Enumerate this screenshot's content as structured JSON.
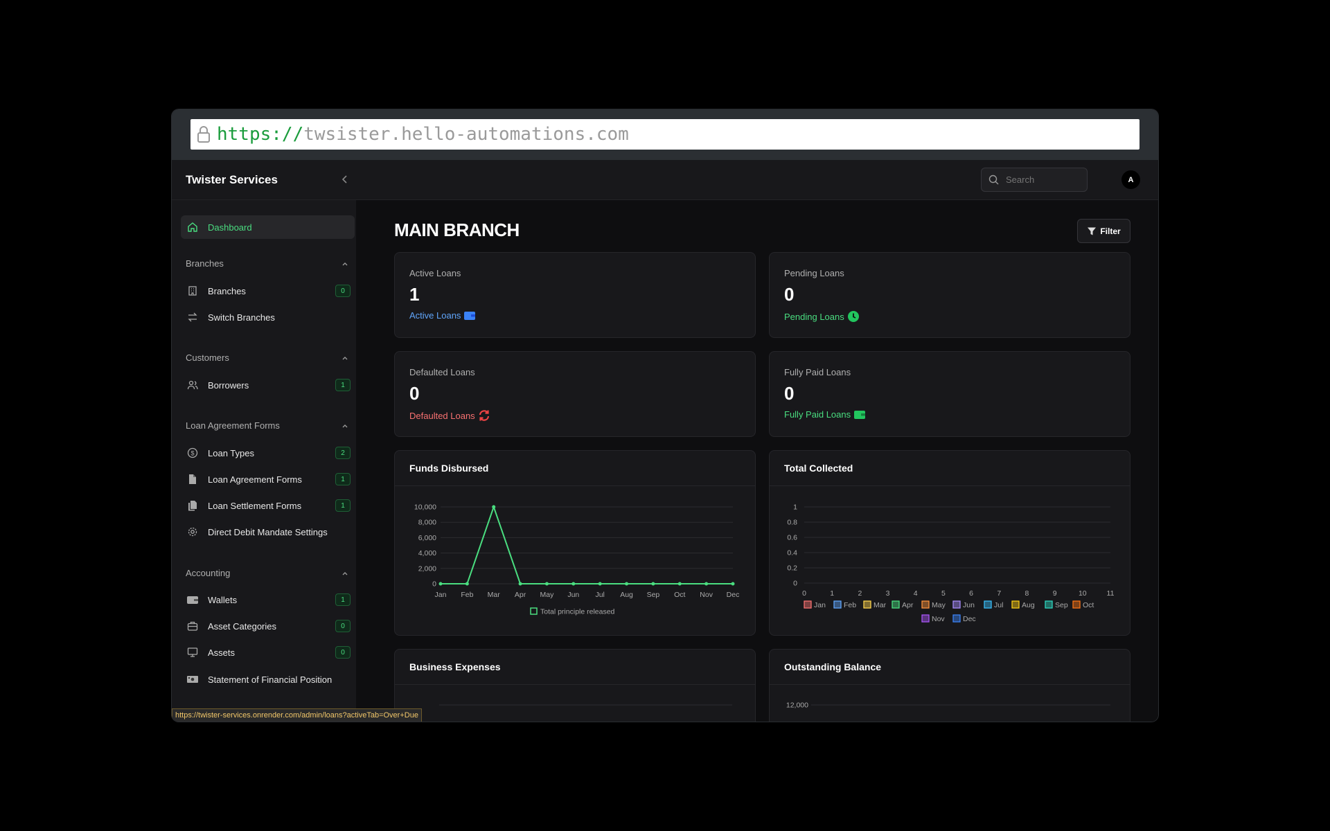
{
  "browser": {
    "url_protocol": "https://",
    "url_host": "twsister.hello-automations.com",
    "status_url": "https://twister-services.onrender.com/admin/loans?activeTab=Over+Due"
  },
  "header": {
    "brand": "Twister Services",
    "search_placeholder": "Search",
    "avatar_initial": "A"
  },
  "sidebar": {
    "dashboard": "Dashboard",
    "sections": {
      "branches": "Branches",
      "customers": "Customers",
      "loan_forms": "Loan Agreement Forms",
      "accounting": "Accounting"
    },
    "items": {
      "branches": {
        "label": "Branches",
        "badge": "0"
      },
      "switch_branches": {
        "label": "Switch Branches"
      },
      "borrowers": {
        "label": "Borrowers",
        "badge": "1"
      },
      "loan_types": {
        "label": "Loan Types",
        "badge": "2"
      },
      "loan_agreement_forms": {
        "label": "Loan Agreement Forms",
        "badge": "1"
      },
      "loan_settlement_forms": {
        "label": "Loan Settlement Forms",
        "badge": "1"
      },
      "direct_debit": {
        "label": "Direct Debit Mandate Settings"
      },
      "wallets": {
        "label": "Wallets",
        "badge": "1"
      },
      "asset_categories": {
        "label": "Asset Categories",
        "badge": "0"
      },
      "assets": {
        "label": "Assets",
        "badge": "0"
      },
      "sofp": {
        "label": "Statement of Financial Position"
      }
    }
  },
  "main": {
    "title": "MAIN BRANCH",
    "filter_label": "Filter",
    "cards": {
      "active": {
        "label": "Active Loans",
        "value": "1",
        "link": "Active Loans",
        "color": "#60a5fa"
      },
      "pending": {
        "label": "Pending Loans",
        "value": "0",
        "link": "Pending Loans",
        "color": "#4ade80"
      },
      "defaulted": {
        "label": "Defaulted Loans",
        "value": "0",
        "link": "Defaulted Loans",
        "color": "#f87171"
      },
      "fully_paid": {
        "label": "Fully Paid Loans",
        "value": "0",
        "link": "Fully Paid Loans",
        "color": "#4ade80"
      }
    },
    "panels": {
      "funds_disbursed": "Funds Disbursed",
      "total_collected": "Total Collected",
      "business_expenses": "Business Expenses",
      "outstanding_balance": "Outstanding Balance"
    }
  },
  "chart_data": [
    {
      "type": "line",
      "title": "Funds Disbursed",
      "categories": [
        "Jan",
        "Feb",
        "Mar",
        "Apr",
        "May",
        "Jun",
        "Jul",
        "Aug",
        "Sep",
        "Oct",
        "Nov",
        "Dec"
      ],
      "series": [
        {
          "name": "Total principle released",
          "values": [
            0,
            0,
            10000,
            0,
            0,
            0,
            0,
            0,
            0,
            0,
            0,
            0
          ]
        }
      ],
      "yticks": [
        "0",
        "2,000",
        "4,000",
        "6,000",
        "8,000",
        "10,000"
      ],
      "ylim": [
        0,
        10000
      ],
      "grid": true,
      "color": "#4ade80"
    },
    {
      "type": "line",
      "title": "Total Collected",
      "xticks": [
        "0",
        "1",
        "2",
        "3",
        "4",
        "5",
        "6",
        "7",
        "8",
        "9",
        "10",
        "11"
      ],
      "yticks": [
        "0",
        "0.2",
        "0.4",
        "0.6",
        "0.8",
        "1"
      ],
      "ylim": [
        0,
        1
      ],
      "grid": true,
      "legend": [
        {
          "name": "Jan",
          "color": "#f87171"
        },
        {
          "name": "Feb",
          "color": "#60a5fa"
        },
        {
          "name": "Mar",
          "color": "#fcd34d"
        },
        {
          "name": "Apr",
          "color": "#4ade80"
        },
        {
          "name": "May",
          "color": "#fb923c"
        },
        {
          "name": "Jun",
          "color": "#a78bfa"
        },
        {
          "name": "Jul",
          "color": "#38bdf8"
        },
        {
          "name": "Aug",
          "color": "#facc15"
        },
        {
          "name": "Sep",
          "color": "#2dd4bf"
        },
        {
          "name": "Oct",
          "color": "#f97316"
        },
        {
          "name": "Nov",
          "color": "#a855f7"
        },
        {
          "name": "Dec",
          "color": "#3b82f6"
        }
      ]
    },
    {
      "type": "line",
      "title": "Outstanding Balance",
      "yticks": [
        "12,000"
      ]
    }
  ]
}
